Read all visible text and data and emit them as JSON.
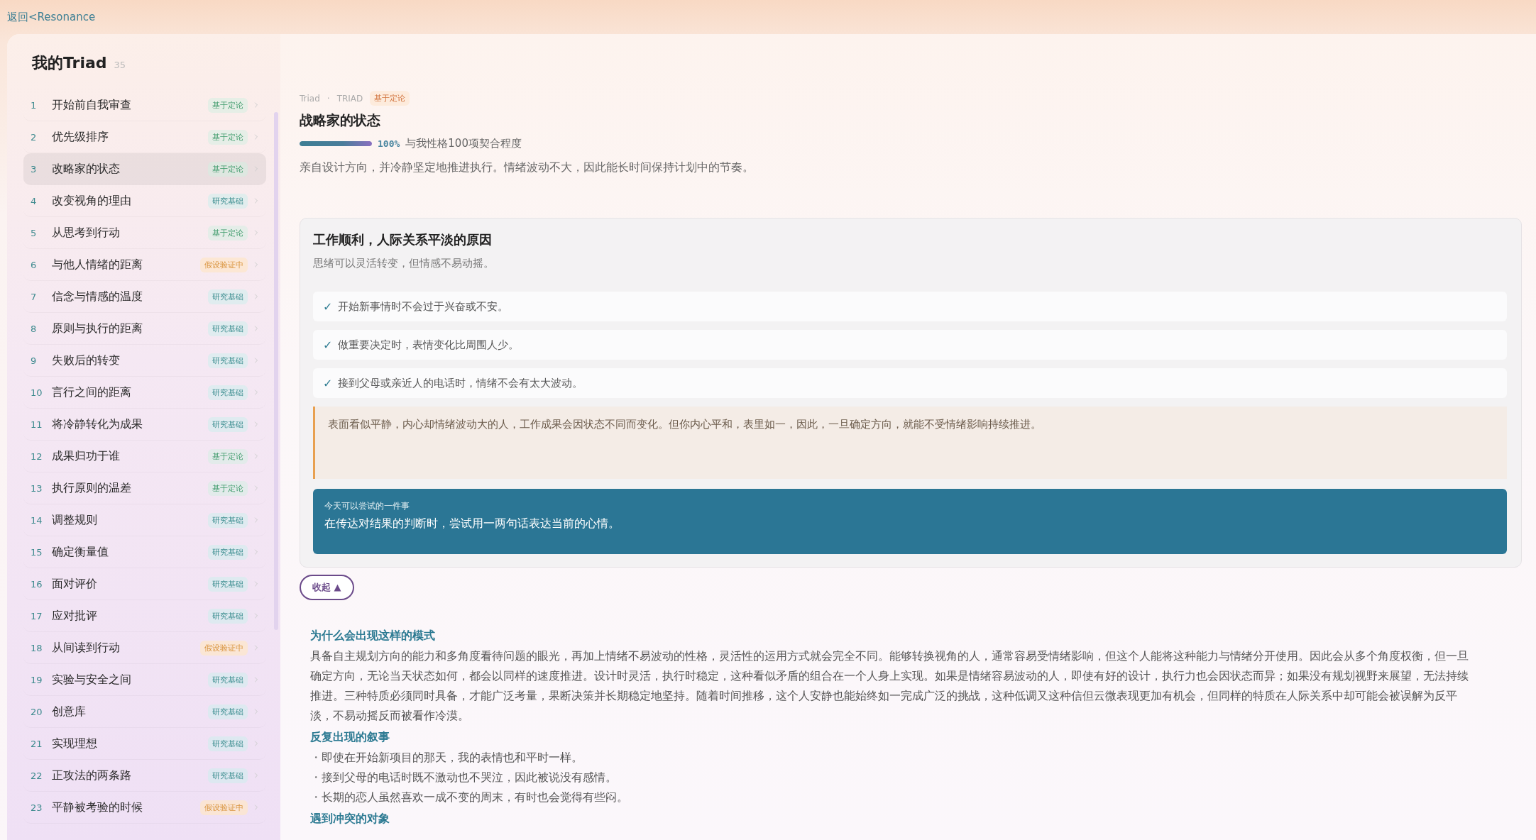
{
  "back_link": "返回<Resonance",
  "sidebar": {
    "title": "我的Triad",
    "count": "35",
    "items": [
      {
        "number": "1",
        "label": "开始前自我审查",
        "tag": {
          "text": "基于定论",
          "kind": "established"
        },
        "selected": false
      },
      {
        "number": "2",
        "label": "优先级排序",
        "tag": {
          "text": "基于定论",
          "kind": "established"
        },
        "selected": false
      },
      {
        "number": "3",
        "label": "改略家的状态",
        "tag": {
          "text": "基于定论",
          "kind": "established"
        },
        "selected": true
      },
      {
        "number": "4",
        "label": "改变视角的理由",
        "tag": {
          "text": "研究基础",
          "kind": "research"
        },
        "selected": false
      },
      {
        "number": "5",
        "label": "从思考到行动",
        "tag": {
          "text": "基于定论",
          "kind": "established"
        },
        "selected": false
      },
      {
        "number": "6",
        "label": "与他人情绪的距离",
        "tag": {
          "text": "假设验证中",
          "kind": "hypothesis"
        },
        "selected": false
      },
      {
        "number": "7",
        "label": "信念与情感的温度",
        "tag": {
          "text": "研究基础",
          "kind": "research"
        },
        "selected": false
      },
      {
        "number": "8",
        "label": "原则与执行的距离",
        "tag": {
          "text": "研究基础",
          "kind": "research"
        },
        "selected": false
      },
      {
        "number": "9",
        "label": "失败后的转变",
        "tag": {
          "text": "研究基础",
          "kind": "research"
        },
        "selected": false
      },
      {
        "number": "10",
        "label": "言行之间的距离",
        "tag": {
          "text": "研究基础",
          "kind": "research"
        },
        "selected": false
      },
      {
        "number": "11",
        "label": "将冷静转化为成果",
        "tag": {
          "text": "研究基础",
          "kind": "research"
        },
        "selected": false
      },
      {
        "number": "12",
        "label": "成果归功于谁",
        "tag": {
          "text": "基于定论",
          "kind": "established"
        },
        "selected": false
      },
      {
        "number": "13",
        "label": "执行原则的温差",
        "tag": {
          "text": "基于定论",
          "kind": "established"
        },
        "selected": false
      },
      {
        "number": "14",
        "label": "调整规则",
        "tag": {
          "text": "研究基础",
          "kind": "research"
        },
        "selected": false
      },
      {
        "number": "15",
        "label": "确定衡量值",
        "tag": {
          "text": "研究基础",
          "kind": "research"
        },
        "selected": false
      },
      {
        "number": "16",
        "label": "面对评价",
        "tag": {
          "text": "研究基础",
          "kind": "research"
        },
        "selected": false
      },
      {
        "number": "17",
        "label": "应对批评",
        "tag": {
          "text": "研究基础",
          "kind": "research"
        },
        "selected": false
      },
      {
        "number": "18",
        "label": "从间读到行动",
        "tag": {
          "text": "假设验证中",
          "kind": "hypothesis"
        },
        "selected": false
      },
      {
        "number": "19",
        "label": "实验与安全之间",
        "tag": {
          "text": "研究基础",
          "kind": "research"
        },
        "selected": false
      },
      {
        "number": "20",
        "label": "创意库",
        "tag": {
          "text": "研究基础",
          "kind": "research"
        },
        "selected": false
      },
      {
        "number": "21",
        "label": "实现理想",
        "tag": {
          "text": "研究基础",
          "kind": "research"
        },
        "selected": false
      },
      {
        "number": "22",
        "label": "正攻法的两条路",
        "tag": {
          "text": "研究基础",
          "kind": "research"
        },
        "selected": false
      },
      {
        "number": "23",
        "label": "平静被考验的时候",
        "tag": {
          "text": "假设验证中",
          "kind": "hypothesis"
        },
        "selected": false
      }
    ]
  },
  "detail": {
    "breadcrumb": [
      "Triad",
      "·",
      "TRIAD"
    ],
    "tag": {
      "text": "基于定论",
      "kind": "highlight"
    },
    "title": "战略家的状态",
    "match": {
      "level": 1,
      "percent": "100%",
      "label": "与我性格100项契合程度"
    },
    "description": "亲自设计方向，并冷静坚定地推进执行。情绪波动不大，因此能长时间保持计划中的节奏。",
    "card": {
      "title": "工作顺利，人际关系平淡的原因",
      "subtitle": "思绪可以灵活转变，但情感不易动摇。",
      "checks": [
        {
          "mark": "✓",
          "text": "开始新事情时不会过于兴奋或不安。"
        },
        {
          "mark": "✓",
          "text": "做重要决定时，表情变化比周围人少。"
        },
        {
          "mark": "✓",
          "text": "接到父母或亲近人的电话时，情绪不会有太大波动。"
        }
      ],
      "quote": "表面看似平静，内心却情绪波动大的人，工作成果会因状态不同而变化。但你内心平和，表里如一，因此，一旦确定方向，就能不受情绪影响持续推进。",
      "tip": {
        "label": "今天可以尝试的一件事",
        "text": "在传达对结果的判断时，尝试用一两句话表达当前的心情。"
      }
    },
    "collapse_button": "收起 ▲",
    "sections": [
      {
        "heading": "为什么会出现这样的模式",
        "kind": "paragraph",
        "text": "具备自主规划方向的能力和多角度看待问题的眼光，再加上情绪不易波动的性格，灵活性的运用方式就会完全不同。能够转换视角的人，通常容易受情绪影响，但这个人能将这种能力与情绪分开使用。因此会从多个角度权衡，但一旦确定方向，无论当天状态如何，都会以同样的速度推进。设计时灵活，执行时稳定，这种看似矛盾的组合在一个人身上实现。如果是情绪容易波动的人，即使有好的设计，执行力也会因状态而异；如果没有规划视野来展望，无法持续推进。三种特质必须同时具备，才能广泛考量，果断决策并长期稳定地坚持。随着时间推移，这个人安静也能始终如一完成广泛的挑战，这种低调又这种信但云微表现更加有机会，但同样的特质在人际关系中却可能会被误解为反平淡，不易动摇反而被看作冷漠。"
      },
      {
        "heading": "反复出现的叙事",
        "kind": "bullets",
        "bullets": [
          {
            "mark": "・",
            "text": "即使在开始新项目的那天，我的表情也和平时一样。"
          },
          {
            "mark": "・",
            "text": "接到父母的电话时既不激动也不哭泣，因此被说没有感情。"
          },
          {
            "mark": "・",
            "text": "长期的恋人虽然喜欢一成不变的周末，有时也会觉得有些闷。"
          }
        ]
      },
      {
        "heading": "遇到冲突的对象",
        "kind": "heading_only"
      }
    ]
  }
}
